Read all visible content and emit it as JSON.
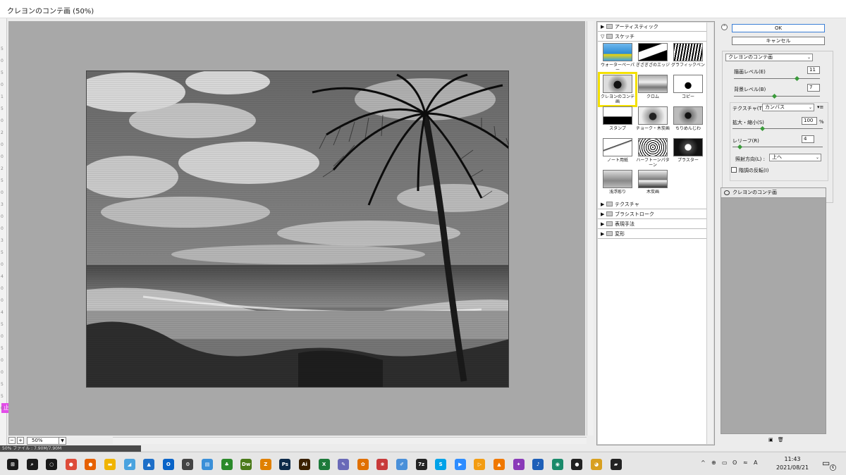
{
  "window": {
    "title": "クレヨンのコンテ画 (50%)"
  },
  "ruler": {
    "numbers": [
      "5",
      "0",
      "5",
      "0",
      "1",
      "5",
      "0",
      "2",
      "0",
      "0",
      "2",
      "5",
      "0",
      "3",
      "0",
      "0",
      "3",
      "5",
      "0",
      "4",
      "0",
      "0",
      "4",
      "5",
      "0",
      "5",
      "0",
      "0",
      "5",
      "5",
      "0"
    ],
    "mark": "止"
  },
  "preview": {
    "zoom": "50%"
  },
  "gallery": {
    "categories_top": [
      {
        "label": "アーティスティック",
        "expanded": false
      }
    ],
    "sketch_category": {
      "label": "スケッチ",
      "expanded": true
    },
    "thumbnails": [
      {
        "label": "ウォーターペーパー"
      },
      {
        "label": "ぎざぎざのエッジ"
      },
      {
        "label": "グラフィックペン"
      },
      {
        "label": "クレヨンのコンテ画",
        "selected": true
      },
      {
        "label": "クロム"
      },
      {
        "label": "コピー"
      },
      {
        "label": "スタンプ"
      },
      {
        "label": "チョーク・木炭画"
      },
      {
        "label": "ちりめんじわ"
      },
      {
        "label": "ノート用紙"
      },
      {
        "label": "ハーフトーンパターン"
      },
      {
        "label": "プラスター"
      },
      {
        "label": "浅浮彫り"
      },
      {
        "label": "木炭画"
      }
    ],
    "categories_bottom": [
      {
        "label": "テクスチャ"
      },
      {
        "label": "ブラシストローク"
      },
      {
        "label": "表現手法"
      },
      {
        "label": "変形"
      }
    ]
  },
  "controls": {
    "ok_label": "OK",
    "cancel_label": "キャンセル",
    "filter_select": "クレヨンのコンテ画",
    "foreground_label": "描画レベル(E)",
    "foreground_value": "11",
    "foreground_level": 0.73,
    "background_label": "背景レベル(B)",
    "background_value": "7",
    "background_level": 0.47,
    "texture_label": "テクスチャ(T) :",
    "texture_select": "カンバス",
    "scaling_label": "拡大・縮小(S)",
    "scaling_value": "100",
    "scaling_unit": "%",
    "scaling_level": 0.33,
    "relief_label": "レリーフ(R)",
    "relief_value": "4",
    "relief_level": 0.08,
    "light_label": "照射方向(L) :",
    "light_select": "上へ",
    "invert_label": "階調の反転(I)"
  },
  "layers": {
    "items": [
      {
        "label": "クレヨンのコンテ画"
      }
    ]
  },
  "statusbar": {
    "text": "50%   ファイル : 7.90M/7.90M"
  },
  "taskbar": {
    "icons": [
      {
        "name": "windows-start-icon",
        "color": "#1a1a1a",
        "text": "⊞"
      },
      {
        "name": "search-icon",
        "color": "#1a1a1a",
        "text": "⌕"
      },
      {
        "name": "cortana-icon",
        "color": "#1a1a1a",
        "text": "○"
      },
      {
        "name": "chrome-icon",
        "color": "#dd4b39",
        "text": "●"
      },
      {
        "name": "firefox-icon",
        "color": "#e66000",
        "text": "●"
      },
      {
        "name": "file-explorer-icon",
        "color": "#f0b400",
        "text": "▬"
      },
      {
        "name": "app-icon-1",
        "color": "#4aa3df",
        "text": "◢"
      },
      {
        "name": "photos-icon",
        "color": "#1e6fc8",
        "text": "▲"
      },
      {
        "name": "outlook-icon",
        "color": "#0a64c8",
        "text": "O"
      },
      {
        "name": "settings-icon",
        "color": "#444",
        "text": "⚙"
      },
      {
        "name": "app-icon-2",
        "color": "#3a8fd8",
        "text": "▤"
      },
      {
        "name": "app-icon-3",
        "color": "#2b8a2b",
        "text": "♣"
      },
      {
        "name": "dreamweaver-icon",
        "color": "#4a7a1a",
        "text": "Dw"
      },
      {
        "name": "app-icon-4",
        "color": "#e08000",
        "text": "Z"
      },
      {
        "name": "photoshop-icon",
        "color": "#0d2a4a",
        "text": "Ps"
      },
      {
        "name": "illustrator-icon",
        "color": "#3a2000",
        "text": "Ai"
      },
      {
        "name": "excel-icon",
        "color": "#1d7a3a",
        "text": "X"
      },
      {
        "name": "app-icon-5",
        "color": "#6a6ab8",
        "text": "✎"
      },
      {
        "name": "butterfly-icon",
        "color": "#e07000",
        "text": "✿"
      },
      {
        "name": "app-icon-6",
        "color": "#c83a3a",
        "text": "❀"
      },
      {
        "name": "app-icon-7",
        "color": "#4a90d9",
        "text": "✐"
      },
      {
        "name": "7zip-icon",
        "color": "#222",
        "text": "7z"
      },
      {
        "name": "skype-icon",
        "color": "#00a2e8",
        "text": "S"
      },
      {
        "name": "zoom-icon",
        "color": "#2d8cff",
        "text": "▶"
      },
      {
        "name": "app-icon-8",
        "color": "#f39c12",
        "text": "▷"
      },
      {
        "name": "vlc-icon",
        "color": "#f07800",
        "text": "▲"
      },
      {
        "name": "app-icon-9",
        "color": "#8a3ab8",
        "text": "✦"
      },
      {
        "name": "music-icon",
        "color": "#1e5fb8",
        "text": "♪"
      },
      {
        "name": "app-icon-10",
        "color": "#1a8a6a",
        "text": "◉"
      },
      {
        "name": "record-icon",
        "color": "#222",
        "text": "●"
      },
      {
        "name": "app-icon-11",
        "color": "#d8a020",
        "text": "◕"
      },
      {
        "name": "sticky-notes-icon",
        "color": "#222",
        "text": "▰"
      }
    ],
    "tray": [
      "^",
      "⊕",
      "▭",
      "ʘ",
      "≈",
      "A"
    ],
    "time": "11:43",
    "date": "2021/08/21",
    "notification_count": "6"
  }
}
